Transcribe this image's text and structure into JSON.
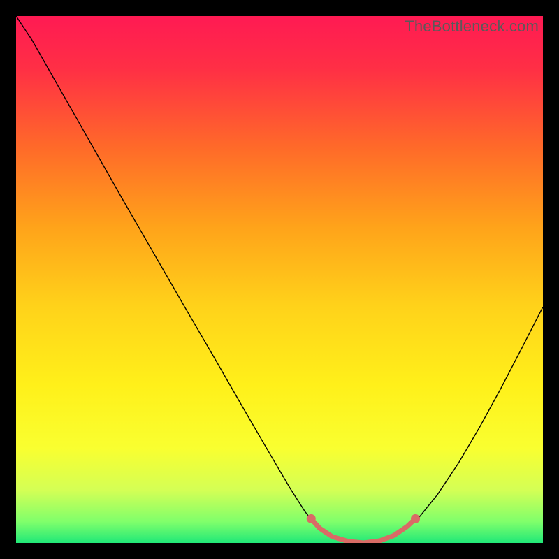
{
  "watermark": "TheBottleneck.com",
  "gradient_stops": [
    {
      "offset": 0.0,
      "color": "#ff1a53"
    },
    {
      "offset": 0.1,
      "color": "#ff2f45"
    },
    {
      "offset": 0.25,
      "color": "#ff6a29"
    },
    {
      "offset": 0.4,
      "color": "#ffa31a"
    },
    {
      "offset": 0.55,
      "color": "#ffd21a"
    },
    {
      "offset": 0.7,
      "color": "#fff01a"
    },
    {
      "offset": 0.82,
      "color": "#f9ff30"
    },
    {
      "offset": 0.9,
      "color": "#d4ff55"
    },
    {
      "offset": 0.96,
      "color": "#7fff6b"
    },
    {
      "offset": 1.0,
      "color": "#20e878"
    }
  ],
  "chart_data": {
    "type": "line",
    "title": "",
    "xlabel": "",
    "ylabel": "",
    "xlim": [
      0,
      1
    ],
    "ylim": [
      0,
      1
    ],
    "series": [
      {
        "name": "curve",
        "stroke": "#000000",
        "width": 1.4,
        "points": [
          {
            "x": 0.0,
            "y": 1.0
          },
          {
            "x": 0.03,
            "y": 0.955
          },
          {
            "x": 0.06,
            "y": 0.902
          },
          {
            "x": 0.1,
            "y": 0.832
          },
          {
            "x": 0.15,
            "y": 0.744
          },
          {
            "x": 0.2,
            "y": 0.656
          },
          {
            "x": 0.26,
            "y": 0.552
          },
          {
            "x": 0.32,
            "y": 0.448
          },
          {
            "x": 0.38,
            "y": 0.345
          },
          {
            "x": 0.43,
            "y": 0.258
          },
          {
            "x": 0.48,
            "y": 0.172
          },
          {
            "x": 0.52,
            "y": 0.104
          },
          {
            "x": 0.548,
            "y": 0.06
          },
          {
            "x": 0.572,
            "y": 0.03
          },
          {
            "x": 0.595,
            "y": 0.012
          },
          {
            "x": 0.62,
            "y": 0.003
          },
          {
            "x": 0.65,
            "y": 0.0
          },
          {
            "x": 0.68,
            "y": 0.002
          },
          {
            "x": 0.71,
            "y": 0.01
          },
          {
            "x": 0.735,
            "y": 0.023
          },
          {
            "x": 0.762,
            "y": 0.045
          },
          {
            "x": 0.8,
            "y": 0.092
          },
          {
            "x": 0.84,
            "y": 0.152
          },
          {
            "x": 0.88,
            "y": 0.22
          },
          {
            "x": 0.92,
            "y": 0.293
          },
          {
            "x": 0.96,
            "y": 0.37
          },
          {
            "x": 1.0,
            "y": 0.448
          }
        ]
      },
      {
        "name": "floor-highlight",
        "stroke": "#d96b66",
        "width": 7,
        "cap": "round",
        "points": [
          {
            "x": 0.56,
            "y": 0.046
          },
          {
            "x": 0.576,
            "y": 0.028
          },
          {
            "x": 0.6,
            "y": 0.012
          },
          {
            "x": 0.63,
            "y": 0.003
          },
          {
            "x": 0.66,
            "y": 0.0
          },
          {
            "x": 0.69,
            "y": 0.004
          },
          {
            "x": 0.717,
            "y": 0.014
          },
          {
            "x": 0.742,
            "y": 0.031
          },
          {
            "x": 0.758,
            "y": 0.046
          }
        ]
      }
    ],
    "markers": [
      {
        "x": 0.56,
        "y": 0.046,
        "r": 6.5,
        "fill": "#d96b66"
      },
      {
        "x": 0.758,
        "y": 0.046,
        "r": 6.5,
        "fill": "#d96b66"
      }
    ]
  }
}
